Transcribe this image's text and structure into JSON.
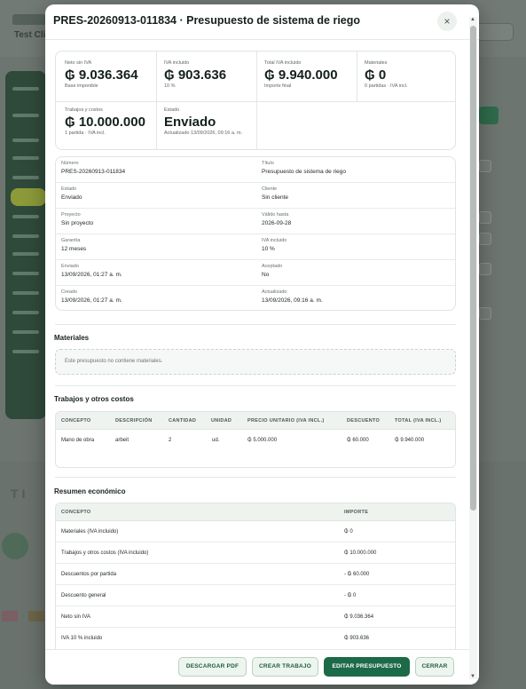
{
  "background": {
    "title": "Test Cli"
  },
  "modal": {
    "title": "PRES-20260913-011834 · Presupuesto de sistema de riego",
    "close_label": "×"
  },
  "summary": {
    "neto": {
      "label": "Neto sin IVA",
      "value": "₲ 9.036.364",
      "sub": "Base imponible"
    },
    "iva": {
      "label": "IVA incluido",
      "value": "₲ 903.636",
      "sub": "10 %"
    },
    "total": {
      "label": "Total IVA incluido",
      "value": "₲ 9.940.000",
      "sub": "Importe final"
    },
    "materiales": {
      "label": "Materiales",
      "value": "₲ 0",
      "sub": "0 partidas · IVA incl."
    },
    "trabajos": {
      "label": "Trabajos y costos",
      "value": "₲ 10.000.000",
      "sub": "1 partida · IVA incl."
    },
    "estado": {
      "label": "Estado",
      "value": "Enviado",
      "sub": "Actualizado 13/09/2026, 09:16 a. m."
    }
  },
  "details": [
    {
      "l1": "Número",
      "v1": "PRES-20260913-011834",
      "l2": "Título",
      "v2": "Presupuesto de sistema de riego"
    },
    {
      "l1": "Estado",
      "v1": "Enviado",
      "l2": "Cliente",
      "v2": "Sin cliente"
    },
    {
      "l1": "Proyecto",
      "v1": "Sin proyecto",
      "l2": "Válido hasta",
      "v2": "2026-09-28"
    },
    {
      "l1": "Garantía",
      "v1": "12 meses",
      "l2": "IVA incluido",
      "v2": "10 %"
    },
    {
      "l1": "Enviado",
      "v1": "13/09/2026, 01:27 a. m.",
      "l2": "Aceptado",
      "v2": "No"
    },
    {
      "l1": "Creado",
      "v1": "13/09/2026, 01:27 a. m.",
      "l2": "Actualizado",
      "v2": "13/09/2026, 09:16 a. m."
    }
  ],
  "materiales": {
    "title": "Materiales",
    "empty": "Este presupuesto no contiene materiales."
  },
  "trabajos": {
    "title": "Trabajos y otros costos",
    "headers": [
      "CONCEPTO",
      "DESCRIPCIÓN",
      "CANTIDAD",
      "UNIDAD",
      "PRECIO UNITARIO (IVA INCL.)",
      "DESCUENTO",
      "TOTAL (IVA INCL.)"
    ],
    "rows": [
      [
        "Mano de obra",
        "arbeit",
        "2",
        "ud.",
        "₲ 5.000.000",
        "₲ 60.000",
        "₲ 9.940.000"
      ]
    ]
  },
  "resumen": {
    "title": "Resumen económico",
    "headers": [
      "CONCEPTO",
      "IMPORTE"
    ],
    "rows": [
      [
        "Materiales (IVA incluido)",
        "₲ 0"
      ],
      [
        "Trabajos y otros costos (IVA incluido)",
        "₲ 10.000.000"
      ],
      [
        "Descuentos por partida",
        "- ₲ 60.000"
      ],
      [
        "Descuento general",
        "- ₲ 0"
      ],
      [
        "Neto sin IVA",
        "₲ 9.036.364"
      ],
      [
        "IVA 10 % incluido",
        "₲ 903.636"
      ]
    ]
  },
  "footer": {
    "pdf": "DESCARGAR PDF",
    "trabajo": "CREAR TRABAJO",
    "editar": "EDITAR PRESUPUESTO",
    "cerrar": "CERRAR"
  },
  "colors": {
    "primary": "#1d6a48",
    "accent_bg": "#edf5ef"
  }
}
